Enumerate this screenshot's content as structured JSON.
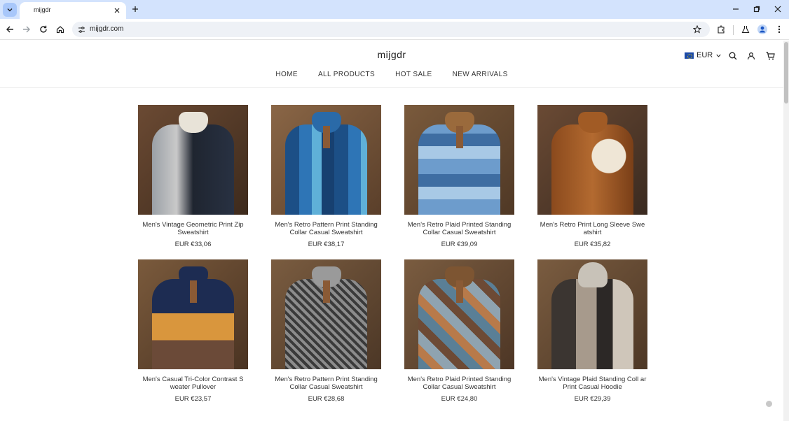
{
  "browser": {
    "tab_title": "mijgdr",
    "url": "mijgdr.com"
  },
  "site": {
    "logo": "mijgdr",
    "currency": "EUR",
    "nav": [
      "HOME",
      "ALL PRODUCTS",
      "HOT SALE",
      "NEW ARRIVALS"
    ]
  },
  "products": [
    {
      "name": "Men's Vintage Geometric Print Zip Sweatshirt",
      "price": "EUR €33,06"
    },
    {
      "name": "Men's Retro Pattern Print Standing Collar Casual Sweatshirt",
      "price": "EUR €38,17"
    },
    {
      "name": "Men's Retro Plaid Printed Standing Collar Casual Sweatshirt",
      "price": "EUR €39,09"
    },
    {
      "name": "Men's Retro Print Long Sleeve Swe atshirt",
      "price": "EUR €35,82"
    },
    {
      "name": "Men's Casual Tri-Color Contrast S weater Pullover",
      "price": "EUR €23,57"
    },
    {
      "name": "Men's Retro Pattern Print Standing Collar Casual Sweatshirt",
      "price": "EUR €28,68"
    },
    {
      "name": "Men's Retro Plaid Printed Standing Collar Casual Sweatshirt",
      "price": "EUR €24,80"
    },
    {
      "name": "Men's Vintage Plaid Standing Coll ar Print Casual Hoodie",
      "price": "EUR €29,39"
    }
  ],
  "colors": {
    "tabstrip": "#d3e3fd",
    "omnibox": "#eef1f6",
    "text": "#333333"
  }
}
